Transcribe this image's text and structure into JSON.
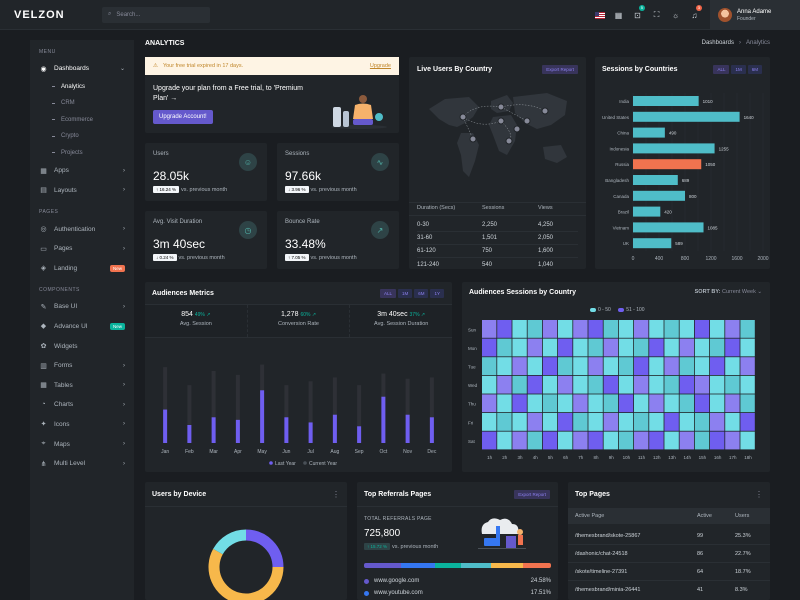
{
  "topbar": {
    "logo": "VELZON",
    "search_placeholder": "Search...",
    "cart_badge": "5",
    "bell_badge": "3",
    "user_name": "Anna Adame",
    "user_role": "Founder",
    "icons": [
      "flag-us-icon",
      "apps-grid-icon",
      "cart-icon",
      "fullscreen-icon",
      "sun-icon",
      "bell-icon"
    ]
  },
  "sidebar": {
    "menu_head": "MENU",
    "dashboards": "Dashboards",
    "dash_subs": [
      "Analytics",
      "CRM",
      "Ecommerce",
      "Crypto",
      "Projects"
    ],
    "apps": "Apps",
    "layouts": "Layouts",
    "pages_head": "PAGES",
    "authentication": "Authentication",
    "pages": "Pages",
    "landing": "Landing",
    "landing_badge": "New",
    "components_head": "COMPONENTS",
    "components": [
      "Base UI",
      "Advance UI",
      "Widgets",
      "Forms",
      "Tables",
      "Charts",
      "Icons",
      "Maps",
      "Multi Level"
    ],
    "advance_badge": "New"
  },
  "page": {
    "title": "ANALYTICS",
    "breadcrumb_parent": "Dashboards",
    "breadcrumb_current": "Analytics"
  },
  "alert": {
    "text": "Your free trial expired in 17 days.",
    "link": "Upgrade"
  },
  "upgrade": {
    "text": "Upgrade your plan from a Free trial, to 'Premium Plan' →",
    "button": "Upgrade Account!"
  },
  "stats": [
    {
      "label": "Users",
      "value": "28.05k",
      "chip": "↑ 16.24 %",
      "sub": "vs. previous month"
    },
    {
      "label": "Sessions",
      "value": "97.66k",
      "chip": "↓ 3.96 %",
      "sub": "vs. previous month"
    },
    {
      "label": "Avg. Visit Duration",
      "value": "3m 40sec",
      "chip": "↓ 0.24 %",
      "sub": "vs. previous month"
    },
    {
      "label": "Bounce Rate",
      "value": "33.48%",
      "chip": "↑ 7.05 %",
      "sub": "vs. previous month"
    }
  ],
  "live_users": {
    "title": "Live Users By Country",
    "button": "Export Report",
    "headers": [
      "Duration (Secs)",
      "Sessions",
      "Views"
    ],
    "rows": [
      [
        "0-30",
        "2,250",
        "4,250"
      ],
      [
        "31-60",
        "1,501",
        "2,050"
      ],
      [
        "61-120",
        "750",
        "1,600"
      ],
      [
        "121-240",
        "540",
        "1,040"
      ]
    ]
  },
  "sessions_country": {
    "title": "Sessions by Countries",
    "filters": [
      "ALL",
      "1M",
      "6M"
    ],
    "highlight_color": "#f1734f",
    "bar_color": "#4fbdc8"
  },
  "audiences": {
    "title": "Audiences Metrics",
    "filters": [
      "ALL",
      "1M",
      "6M",
      "1Y"
    ],
    "metrics": [
      {
        "value": "854",
        "chg": "49%",
        "label": "Avg. Session"
      },
      {
        "value": "1,278",
        "chg": "60%",
        "label": "Conversion Rate"
      },
      {
        "value": "3m 40sec",
        "chg": "37%",
        "label": "Avg. Session Duration"
      }
    ]
  },
  "heatmap": {
    "title": "Audiences Sessions by Country",
    "sort_label": "SORT BY:",
    "sort_value": "Current Week",
    "legend": [
      "0 - 50",
      "51 - 100"
    ],
    "days": [
      "Sun",
      "Mon",
      "Tue",
      "Wed",
      "Thu",
      "Fri",
      "Sat"
    ],
    "hours": [
      "1h",
      "2h",
      "3h",
      "4h",
      "5h",
      "6h",
      "7h",
      "8h",
      "9h",
      "10h",
      "11h",
      "12h",
      "13h",
      "14h",
      "15h",
      "16h",
      "17h",
      "18h"
    ]
  },
  "users_device": {
    "title": "Users by Device"
  },
  "referrals": {
    "title": "Top Referrals Pages",
    "button": "Export Report",
    "label": "TOTAL REFERRALS PAGE",
    "value": "725,800",
    "chip": "↑ 15.72 %",
    "sub": "vs. previous month",
    "sites": [
      {
        "name": "www.google.com",
        "pct": "24.58%",
        "color": "#6559cc"
      },
      {
        "name": "www.youtube.com",
        "pct": "17.51%",
        "color": "#3577f1"
      }
    ],
    "bar_colors": [
      "#6559cc",
      "#3577f1",
      "#0ab39c",
      "#4fbdc8",
      "#f7b84b",
      "#f1734f"
    ]
  },
  "top_pages": {
    "title": "Top Pages",
    "headers": [
      "Active Page",
      "Active",
      "Users"
    ],
    "rows": [
      [
        "/themesbrand/skote-25867",
        "99",
        "25.3%"
      ],
      [
        "/dashonic/chat-24518",
        "86",
        "22.7%"
      ],
      [
        "/skote/timeline-27391",
        "64",
        "18.7%"
      ],
      [
        "/themesbrand/minia-26441",
        "41",
        "8.3%"
      ]
    ]
  },
  "chart_data": [
    {
      "type": "bar",
      "title": "Sessions by Countries",
      "orientation": "horizontal",
      "categories": [
        "India",
        "United States",
        "China",
        "Indonesia",
        "Russia",
        "Bangladesh",
        "Canada",
        "Brazil",
        "Vietnam",
        "UK"
      ],
      "values": [
        1010,
        1640,
        490,
        1255,
        1050,
        689,
        800,
        420,
        1085,
        589
      ],
      "highlighted": "Russia",
      "xlim": [
        0,
        2000
      ],
      "x_ticks": [
        "0",
        "200",
        "400",
        "600",
        "800",
        "1000",
        "1200",
        "1400",
        "1600",
        "1800",
        "2000"
      ]
    },
    {
      "type": "bar",
      "title": "Audiences Metrics",
      "categories": [
        "Jan",
        "Feb",
        "Mar",
        "Apr",
        "May",
        "Jun",
        "Jul",
        "Aug",
        "Sep",
        "Oct",
        "Nov",
        "Dec"
      ],
      "series": [
        {
          "name": "Last Year",
          "values": [
            26,
            14,
            20,
            18,
            41,
            20,
            16,
            22,
            13,
            36,
            22,
            20
          ],
          "color": "#6f5ef0"
        },
        {
          "name": "Current Year",
          "values": [
            59,
            45,
            56,
            53,
            61,
            45,
            48,
            51,
            45,
            54,
            50,
            51
          ],
          "color": "#2e3036"
        }
      ]
    },
    {
      "type": "pie",
      "title": "Users by Device",
      "slices": [
        {
          "value": 25,
          "color": "#6f5ef0"
        },
        {
          "value": 58,
          "color": "#f7b84b"
        },
        {
          "value": 17,
          "color": "#72dde6"
        }
      ]
    },
    {
      "type": "heatmap",
      "title": "Audiences Sessions by Country",
      "rows": [
        "Sun",
        "Mon",
        "Tue",
        "Wed",
        "Thu",
        "Fri",
        "Sat"
      ],
      "cols": [
        "1h",
        "2h",
        "3h",
        "4h",
        "5h",
        "6h",
        "7h",
        "8h",
        "9h",
        "10h",
        "11h",
        "12h",
        "13h",
        "14h",
        "15h",
        "16h",
        "17h",
        "18h"
      ],
      "colors": [
        "#72dde6",
        "#5fc9d3",
        "#8c80f0",
        "#6f5ef0"
      ],
      "levels": [
        [
          2,
          3,
          0,
          1,
          2,
          0,
          2,
          3,
          1,
          0,
          2,
          0,
          1,
          0,
          3,
          0,
          2,
          1
        ],
        [
          3,
          1,
          0,
          2,
          0,
          3,
          0,
          1,
          2,
          0,
          1,
          3,
          0,
          2,
          0,
          1,
          3,
          0
        ],
        [
          1,
          0,
          2,
          0,
          3,
          1,
          0,
          2,
          0,
          1,
          3,
          0,
          2,
          1,
          0,
          3,
          0,
          2
        ],
        [
          0,
          2,
          1,
          3,
          0,
          2,
          0,
          1,
          3,
          0,
          2,
          0,
          1,
          3,
          2,
          0,
          1,
          0
        ],
        [
          2,
          0,
          3,
          0,
          1,
          0,
          2,
          0,
          1,
          3,
          0,
          2,
          0,
          1,
          3,
          0,
          2,
          1
        ],
        [
          0,
          1,
          0,
          2,
          0,
          3,
          1,
          0,
          2,
          0,
          1,
          0,
          3,
          0,
          1,
          2,
          0,
          3
        ],
        [
          3,
          0,
          2,
          1,
          3,
          0,
          2,
          3,
          0,
          1,
          2,
          3,
          0,
          2,
          1,
          3,
          2,
          0
        ]
      ]
    }
  ]
}
